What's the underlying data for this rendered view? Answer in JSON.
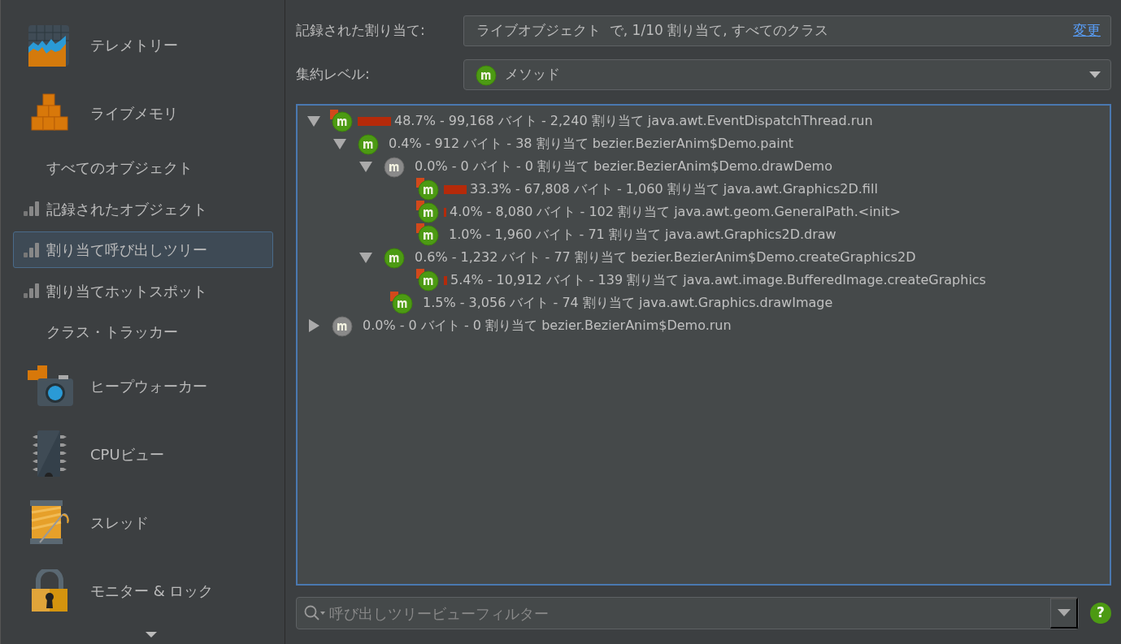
{
  "sidebar": {
    "items": [
      {
        "kind": "section",
        "label": "テレメトリー",
        "selected": false
      },
      {
        "kind": "section",
        "label": "ライブメモリ",
        "selected": false
      },
      {
        "kind": "view",
        "label": "すべてのオブジェクト",
        "has_data": false,
        "selected": false
      },
      {
        "kind": "view",
        "label": "記録されたオブジェクト",
        "has_data": true,
        "selected": false
      },
      {
        "kind": "view",
        "label": "割り当て呼び出しツリー",
        "has_data": true,
        "selected": true
      },
      {
        "kind": "view",
        "label": "割り当てホットスポット",
        "has_data": true,
        "selected": false
      },
      {
        "kind": "view",
        "label": "クラス・トラッカー",
        "has_data": false,
        "selected": false
      },
      {
        "kind": "section",
        "label": "ヒープウォーカー",
        "selected": false
      },
      {
        "kind": "section",
        "label": "CPUビュー",
        "selected": false
      },
      {
        "kind": "section",
        "label": "スレッド",
        "selected": false
      },
      {
        "kind": "section",
        "label": "モニター & ロック",
        "selected": false
      }
    ]
  },
  "recorded": {
    "label": "記録された割り当て:",
    "value": "ライブオブジェクト  で, 1/10 割り当て, すべてのクラス",
    "link": "変更"
  },
  "aggregation": {
    "label": "集約レベル:",
    "value": "メソッド"
  },
  "tree": [
    {
      "kind": "method",
      "hot": true,
      "expanded": true,
      "text": "48.7% - 99,168 バイト - 2,240 割り当て java.awt.EventDispatchThread.run",
      "children": [
        {
          "kind": "method",
          "hot": false,
          "expanded": true,
          "text": "0.4% - 912 バイト - 38 割り当て bezier.BezierAnim$Demo.paint",
          "children": [
            {
              "kind": "inactive",
              "hot": false,
              "expanded": true,
              "text": "0.0% - 0 バイト - 0 割り当て bezier.BezierAnim$Demo.drawDemo",
              "children": [
                {
                  "kind": "method",
                  "hot": true,
                  "text": "33.3% - 67,808 バイト - 1,060 割り当て java.awt.Graphics2D.fill"
                },
                {
                  "kind": "method",
                  "hot": true,
                  "text": "4.0% - 8,080 バイト - 102 割り当て java.awt.geom.GeneralPath.<init>"
                },
                {
                  "kind": "method",
                  "hot": true,
                  "text": "1.0% - 1,960 バイト - 71 割り当て java.awt.Graphics2D.draw"
                }
              ]
            },
            {
              "kind": "method",
              "hot": false,
              "expanded": true,
              "text": "0.6% - 1,232 バイト - 77 割り当て bezier.BezierAnim$Demo.createGraphics2D",
              "children": [
                {
                  "kind": "method",
                  "hot": true,
                  "text": "5.4% - 10,912 バイト - 139 割り当て java.awt.image.BufferedImage.createGraphics"
                }
              ]
            },
            {
              "kind": "method",
              "hot": true,
              "text": "1.5% - 3,056 バイト - 74 割り当て java.awt.Graphics.drawImage"
            }
          ]
        }
      ]
    },
    {
      "kind": "inactive",
      "hot": false,
      "expanded": false,
      "text": "0.0% - 0 バイト - 0 割り当て bezier.BezierAnim$Demo.run"
    }
  ],
  "filter": {
    "placeholder": "呼び出しツリービューフィルター"
  },
  "help": "?"
}
